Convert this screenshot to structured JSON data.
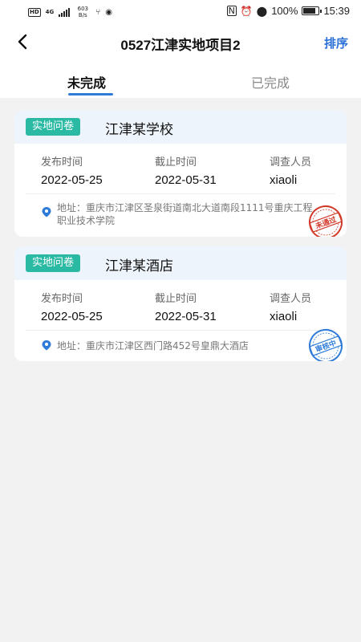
{
  "status_bar": {
    "network": "4G",
    "hd": "HD",
    "speed": "603 B/s",
    "battery": "100%",
    "time": "15:39"
  },
  "header": {
    "title": "0527江津实地项目2",
    "sort_label": "排序"
  },
  "tabs": {
    "incomplete": "未完成",
    "complete": "已完成"
  },
  "cards": [
    {
      "tag": "实地问卷",
      "title": "江津某学校",
      "publish_label": "发布时间",
      "publish_date": "2022-05-25",
      "deadline_label": "截止时间",
      "deadline_date": "2022-05-31",
      "surveyor_label": "调查人员",
      "surveyor": "xiaoli",
      "address": "地址：重庆市江津区圣泉街道南北大道南段1111号重庆工程职业技术学院",
      "stamp": "未通过",
      "stamp_color": "#d23a2a"
    },
    {
      "tag": "实地问卷",
      "title": "江津某酒店",
      "publish_label": "发布时间",
      "publish_date": "2022-05-25",
      "deadline_label": "截止时间",
      "deadline_date": "2022-05-31",
      "surveyor_label": "调查人员",
      "surveyor": "xiaoli",
      "address": "地址：重庆市江津区西门路452号皇鼎大酒店",
      "stamp": "审核中",
      "stamp_color": "#2f7cd8"
    }
  ],
  "colors": {
    "accent": "#2f7cd8",
    "tag": "#2ab9a3",
    "card_head": "#eef4fb"
  }
}
